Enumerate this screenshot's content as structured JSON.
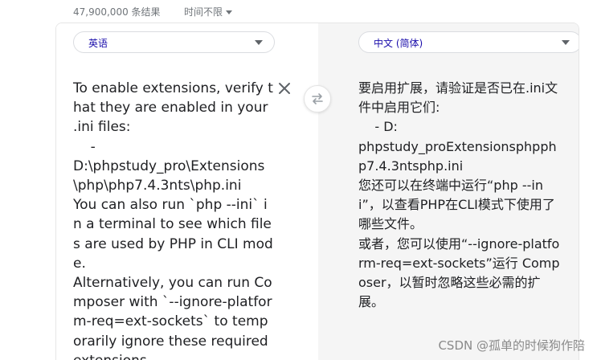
{
  "search_meta": {
    "result_count": "47,900,000 条结果",
    "time_filter_label": "时间不限"
  },
  "translator": {
    "source_language": "英语",
    "target_language": "中文 (简体)",
    "source_text": "To enable extensions, verify that they are enabled in your .ini files:\n    -\nD:\\phpstudy_pro\\Extensions\\php\\php7.4.3nts\\php.ini\nYou can also run `php --ini` in a terminal to see which files are used by PHP in CLI mode.\nAlternatively, you can run Composer with `--ignore-platform-req=ext-sockets` to temporarily ignore these required extensions.",
    "target_text": "要启用扩展，请验证是否已在.ini文件中启用它们:\n    - D:\nphpstudy_proExtensionsphpphp7.4.3ntsphp.ini\n您还可以在终端中运行“php --ini”，以查看PHP在CLI模式下使用了哪些文件。\n或者，您可以使用“--ignore-platform-req=ext-sockets”运行 Composer，以暂时忽略这些必需的扩展。",
    "icons": {
      "clear": "close-icon",
      "swap": "swap-languages-icon",
      "dropdown": "chevron-down-icon"
    }
  },
  "watermark": "CSDN @孤单的时候狗作陪",
  "colors": {
    "lang_label": "#1a0dab",
    "target_pane_bg": "#f5f5f5",
    "muted_text": "#70757a"
  }
}
